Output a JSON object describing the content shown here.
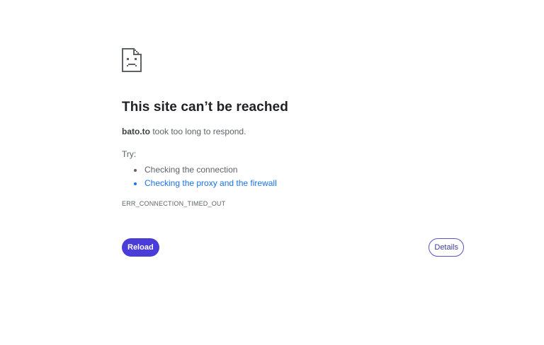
{
  "error_page": {
    "icon": "sad-document-icon",
    "title": "This site can’t be reached",
    "host": "bato.to",
    "message_suffix": " took too long to respond.",
    "try_label": "Try:",
    "suggestions": [
      {
        "text": "Checking the connection",
        "is_link": false
      },
      {
        "text": "Checking the proxy and the firewall",
        "is_link": true
      }
    ],
    "error_code": "ERR_CONNECTION_TIMED_OUT"
  },
  "buttons": {
    "reload_label": "Reload",
    "details_label": "Details"
  },
  "colors": {
    "primary_button": "#4a3cd8",
    "link": "#1a73e8",
    "title_text": "#202124",
    "body_text": "#5f6368"
  }
}
